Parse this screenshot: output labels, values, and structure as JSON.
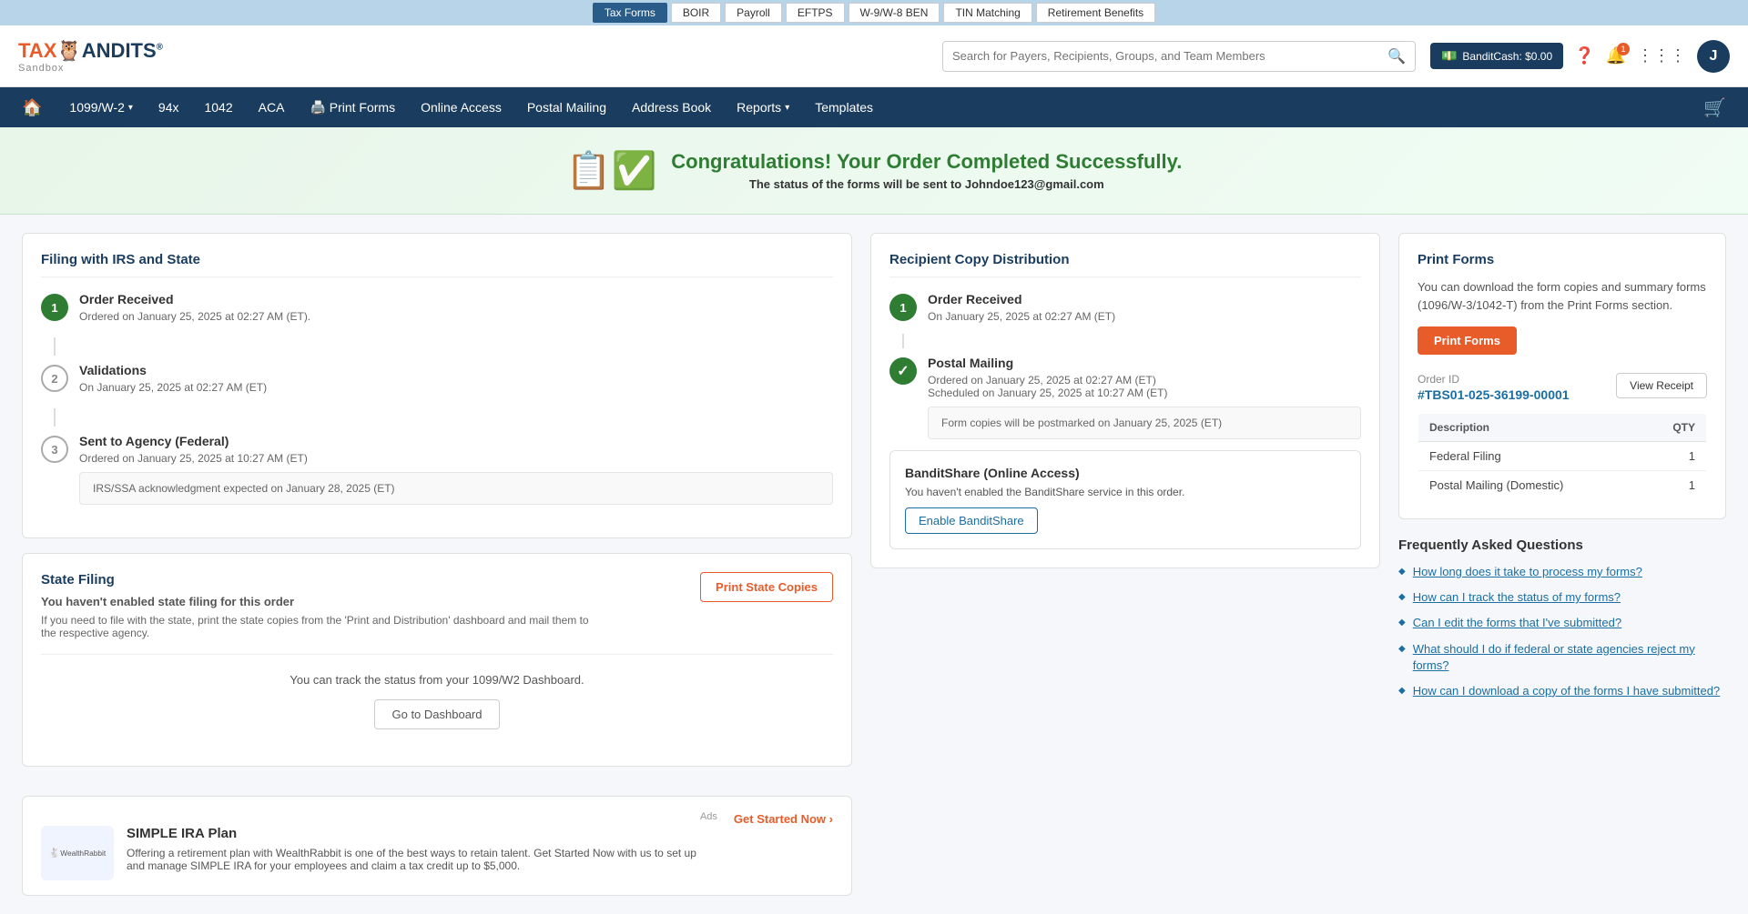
{
  "topbar": {
    "items": [
      {
        "label": "Tax Forms",
        "active": true
      },
      {
        "label": "BOIR",
        "active": false
      },
      {
        "label": "Payroll",
        "active": false
      },
      {
        "label": "EFTPS",
        "active": false
      },
      {
        "label": "W-9/W-8 BEN",
        "active": false
      },
      {
        "label": "TIN Matching",
        "active": false
      },
      {
        "label": "Retirement Benefits",
        "active": false
      }
    ]
  },
  "header": {
    "logo_tax": "TAX",
    "logo_bandits": "ANDITS",
    "logo_registered": "®",
    "logo_sandbox": "Sandbox",
    "search_placeholder": "Search for Payers, Recipients, Groups, and Team Members",
    "bandit_cash_label": "BanditCash: $0.00",
    "avatar_letter": "J"
  },
  "nav": {
    "home_icon": "🏠",
    "items": [
      {
        "label": "1099/W-2",
        "dropdown": true
      },
      {
        "label": "94x"
      },
      {
        "label": "1042"
      },
      {
        "label": "ACA"
      },
      {
        "label": "Print Forms",
        "icon": "🖨️"
      },
      {
        "label": "Online Access"
      },
      {
        "label": "Postal Mailing"
      },
      {
        "label": "Address Book"
      },
      {
        "label": "Reports",
        "dropdown": true
      },
      {
        "label": "Templates"
      }
    ],
    "cart_icon": "🛒"
  },
  "success": {
    "title": "Congratulations! Your Order Completed Successfully.",
    "subtitle": "The status of the forms will be sent to",
    "email": "Johndoe123@gmail.com"
  },
  "filing_section": {
    "title": "Filing with IRS and State",
    "steps": [
      {
        "number": "1",
        "filled": true,
        "label": "Order Received",
        "detail": "Ordered on January 25, 2025 at 02:27 AM (ET)."
      },
      {
        "number": "2",
        "filled": false,
        "label": "Validations",
        "detail": "On January 25, 2025 at 02:27 AM (ET)"
      },
      {
        "number": "3",
        "filled": false,
        "label": "Sent to Agency (Federal)",
        "detail": "Ordered on January 25, 2025 at 10:27 AM (ET)"
      }
    ],
    "irs_note": "IRS/SSA acknowledgment expected on January 28, 2025 (ET)"
  },
  "recipient_section": {
    "title": "Recipient Copy Distribution",
    "step1_label": "Order Received",
    "step1_detail": "On January 25, 2025 at 02:27 AM (ET)",
    "step2_label": "Postal Mailing",
    "step2_ordered": "Ordered on January 25, 2025 at 02:27 AM (ET)",
    "step2_scheduled": "Scheduled on January 25, 2025 at 10:27 AM (ET)",
    "step2_note": "Form copies will be postmarked on January 25, 2025 (ET)",
    "bandit_share_title": "BanditShare (Online Access)",
    "bandit_share_sub": "You haven't enabled the BanditShare service in this order.",
    "enable_bandit_btn": "Enable BanditShare"
  },
  "state_filing": {
    "title": "State Filing",
    "desc": "You haven't enabled state filing for this order",
    "sub": "If you need to file with the state, print the state copies from the 'Print and Distribution' dashboard and mail them to the respective agency.",
    "print_btn": "Print State Copies",
    "dashboard_text": "You can track the status from your 1099/W2 Dashboard.",
    "go_btn": "Go to Dashboard"
  },
  "ads": {
    "label": "Ads",
    "title": "SIMPLE IRA Plan",
    "desc": "Offering a retirement plan with WealthRabbit is one of the best ways to retain talent. Get Started Now with us to set up and manage SIMPLE IRA for your employees and claim a tax credit up to $5,000.",
    "cta": "Get Started Now ›",
    "logo_text": "🐇 WealthRabbit"
  },
  "print_forms": {
    "title": "Print Forms",
    "desc": "You can download the form copies and summary forms (1096/W-3/1042-T) from the Print Forms section.",
    "btn": "Print Forms"
  },
  "order_summary": {
    "label": "Order ID",
    "order_id": "#TBS01-025-36199-00001",
    "view_receipt_btn": "View Receipt",
    "columns": [
      "Description",
      "QTY"
    ],
    "rows": [
      {
        "description": "Federal Filing",
        "qty": "1"
      },
      {
        "description": "Postal Mailing (Domestic)",
        "qty": "1"
      }
    ]
  },
  "faq": {
    "title": "Frequently Asked Questions",
    "items": [
      {
        "question": "How long does it take to process my forms?"
      },
      {
        "question": "How can I track the status of my forms?"
      },
      {
        "question": "Can I edit the forms that I've submitted?"
      },
      {
        "question": "What should I do if federal or state agencies reject my forms?"
      },
      {
        "question": "How can I download a copy of the forms I have submitted?"
      }
    ]
  }
}
